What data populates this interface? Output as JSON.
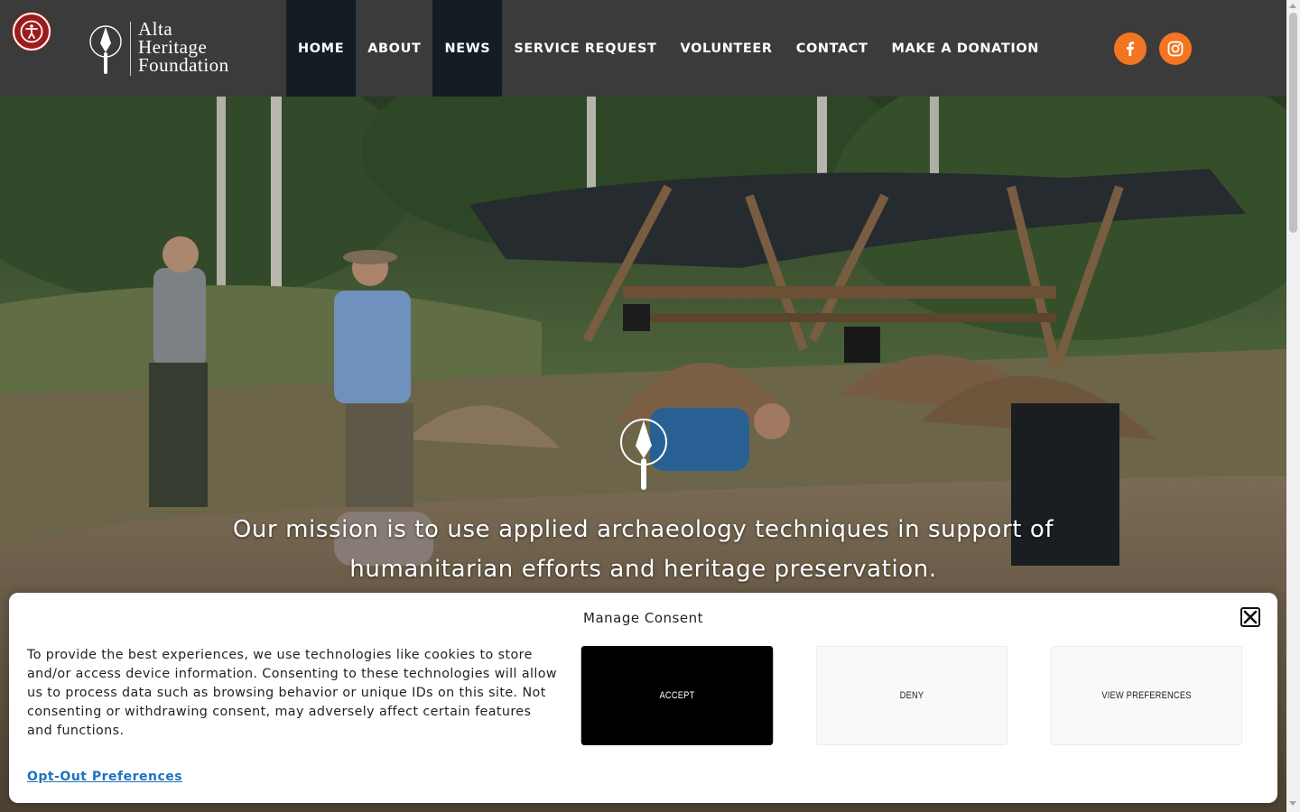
{
  "header": {
    "logo": {
      "line1": "Alta",
      "line2": "Heritage",
      "line3": "Foundation"
    },
    "nav": [
      {
        "label": "HOME"
      },
      {
        "label": "ABOUT"
      },
      {
        "label": "NEWS"
      },
      {
        "label": "SERVICE REQUEST"
      },
      {
        "label": "VOLUNTEER"
      },
      {
        "label": "CONTACT"
      },
      {
        "label": "MAKE A DONATION"
      }
    ],
    "active_nav": "HOME",
    "social": [
      "facebook-icon",
      "instagram-icon"
    ],
    "accessibility_icon": "accessibility-icon"
  },
  "hero": {
    "mission": "Our mission is to use applied archaeology techniques in support of humanitarian efforts and heritage preservation."
  },
  "consent": {
    "title": "Manage Consent",
    "body": "To provide the best experiences, we use technologies like cookies to store and/or access device information. Consenting to these technologies will allow us to process data such as browsing behavior or unique IDs on this site. Not consenting or withdrawing consent, may adversely affect certain features and functions.",
    "accept_label": "Accept",
    "deny_label": "Deny",
    "preferences_label": "View preferences",
    "optout_label": "Opt-Out Preferences"
  },
  "colors": {
    "header_bg": "#3b3b3b",
    "nav_active_bg": "#141c24",
    "social_bg": "#f37521",
    "a11y_bg": "#9c1c1c",
    "link": "#1e73be"
  }
}
